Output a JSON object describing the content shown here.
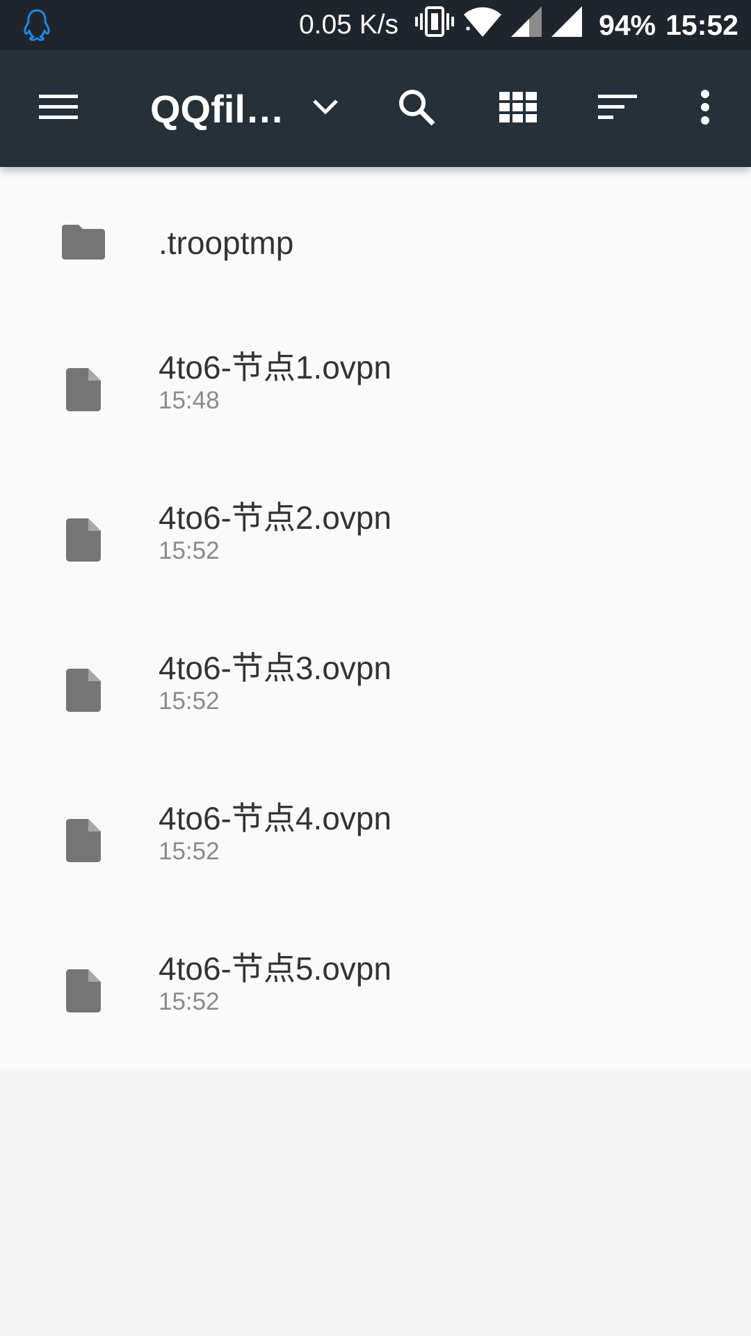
{
  "status_bar": {
    "app_icon": "qq-penguin-icon",
    "net_speed": "0.05 K/s",
    "icons": [
      "vibrate-icon",
      "wifi-icon",
      "signal-icon",
      "signal-icon"
    ],
    "battery": "94%",
    "time": "15:52"
  },
  "toolbar": {
    "menu_icon": "menu-icon",
    "title": "QQfil…",
    "dropdown_icon": "chevron-down-icon",
    "search_icon": "search-icon",
    "grid_icon": "grid-view-icon",
    "sort_icon": "sort-icon",
    "more_icon": "more-vert-icon"
  },
  "files": [
    {
      "type": "folder",
      "name": ".trooptmp",
      "time": ""
    },
    {
      "type": "file",
      "name": "4to6-节点1.ovpn",
      "time": "15:48"
    },
    {
      "type": "file",
      "name": "4to6-节点2.ovpn",
      "time": "15:52"
    },
    {
      "type": "file",
      "name": "4to6-节点3.ovpn",
      "time": "15:52"
    },
    {
      "type": "file",
      "name": "4to6-节点4.ovpn",
      "time": "15:52"
    },
    {
      "type": "file",
      "name": "4to6-节点5.ovpn",
      "time": "15:52"
    }
  ],
  "colors": {
    "status_bar_bg": "#1e252b",
    "toolbar_bg": "#263038",
    "list_bg": "#fafafa",
    "icon_gray": "#757575",
    "qq_blue": "#1e88e5"
  }
}
